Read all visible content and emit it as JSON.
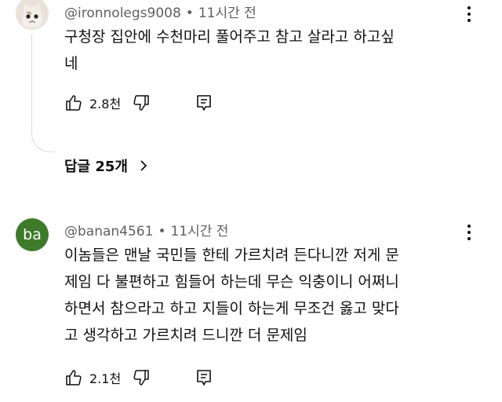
{
  "comments": [
    {
      "username": "@ironnolegs9008",
      "time": "11시간 전",
      "text": "구청장 집안에 수천마리 풀어주고 참고 살라고 하고싶\n네",
      "likes": "2.8천",
      "replies_label": "답글 25개",
      "avatar_icon": "cat-avatar-icon"
    },
    {
      "username": "@banan4561",
      "time": "11시간 전",
      "avatar_text": "ba",
      "text": "이놈들은 맨날 국민들 한테 가르치려 든다니깐 저게 문\n제임 다 불편하고 힘들어 하는데 무슨 익충이니 어쩌니\n하면서 참으라고 하고 지들이 하는게 무조건 옳고 맞다\n고 생각하고 가르치려 드니깐 더 문제임",
      "likes": "2.1천"
    }
  ],
  "separator": "•",
  "colors": {
    "avatar_ba_bg": "#3d7a2a",
    "meta_text": "#606060",
    "thread_line": "#d9d9d9"
  }
}
